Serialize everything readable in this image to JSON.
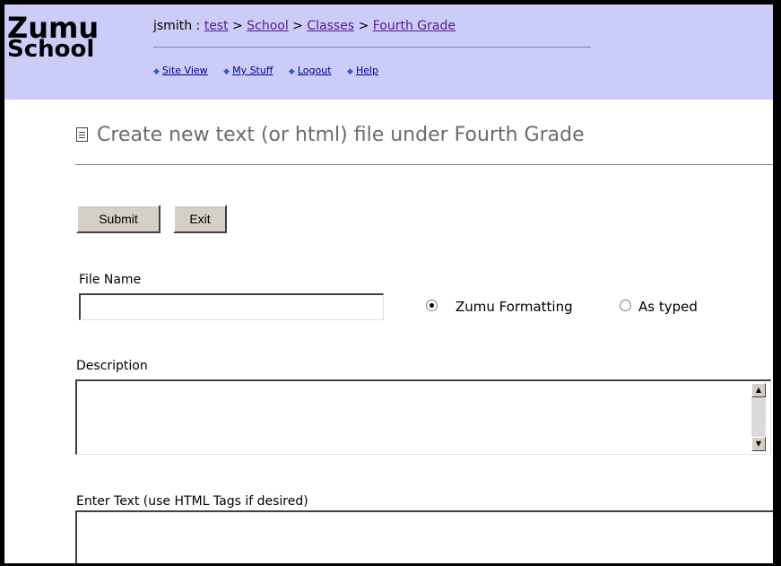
{
  "logo": {
    "line1": "Zumu",
    "line2": "School"
  },
  "breadcrumb": {
    "user": "jsmith",
    "separator": ":",
    "arrow": ">",
    "items": [
      "test",
      "School",
      "Classes",
      "Fourth Grade"
    ]
  },
  "nav": {
    "items": [
      {
        "label": "Site View",
        "icon": "diamond-icon"
      },
      {
        "label": "My Stuff",
        "icon": "diamond-icon"
      },
      {
        "label": "Logout",
        "icon": "diamond-icon"
      },
      {
        "label": "Help",
        "icon": "diamond-icon"
      }
    ]
  },
  "page": {
    "title": "Create new text (or html) file under Fourth Grade",
    "title_icon": "document-icon"
  },
  "buttons": {
    "submit": "Submit",
    "exit": "Exit"
  },
  "form": {
    "file_name_label": "File Name",
    "file_name_value": "",
    "formatting_options": [
      "Zumu Formatting",
      "As typed"
    ],
    "formatting_selected": "Zumu Formatting",
    "description_label": "Description",
    "description_value": "",
    "text_label": "Enter Text (use HTML Tags if desired)",
    "text_value": ""
  },
  "colors": {
    "header_bg": "#ccccf9",
    "link": "#551a8b",
    "nav_link": "#00008b"
  }
}
